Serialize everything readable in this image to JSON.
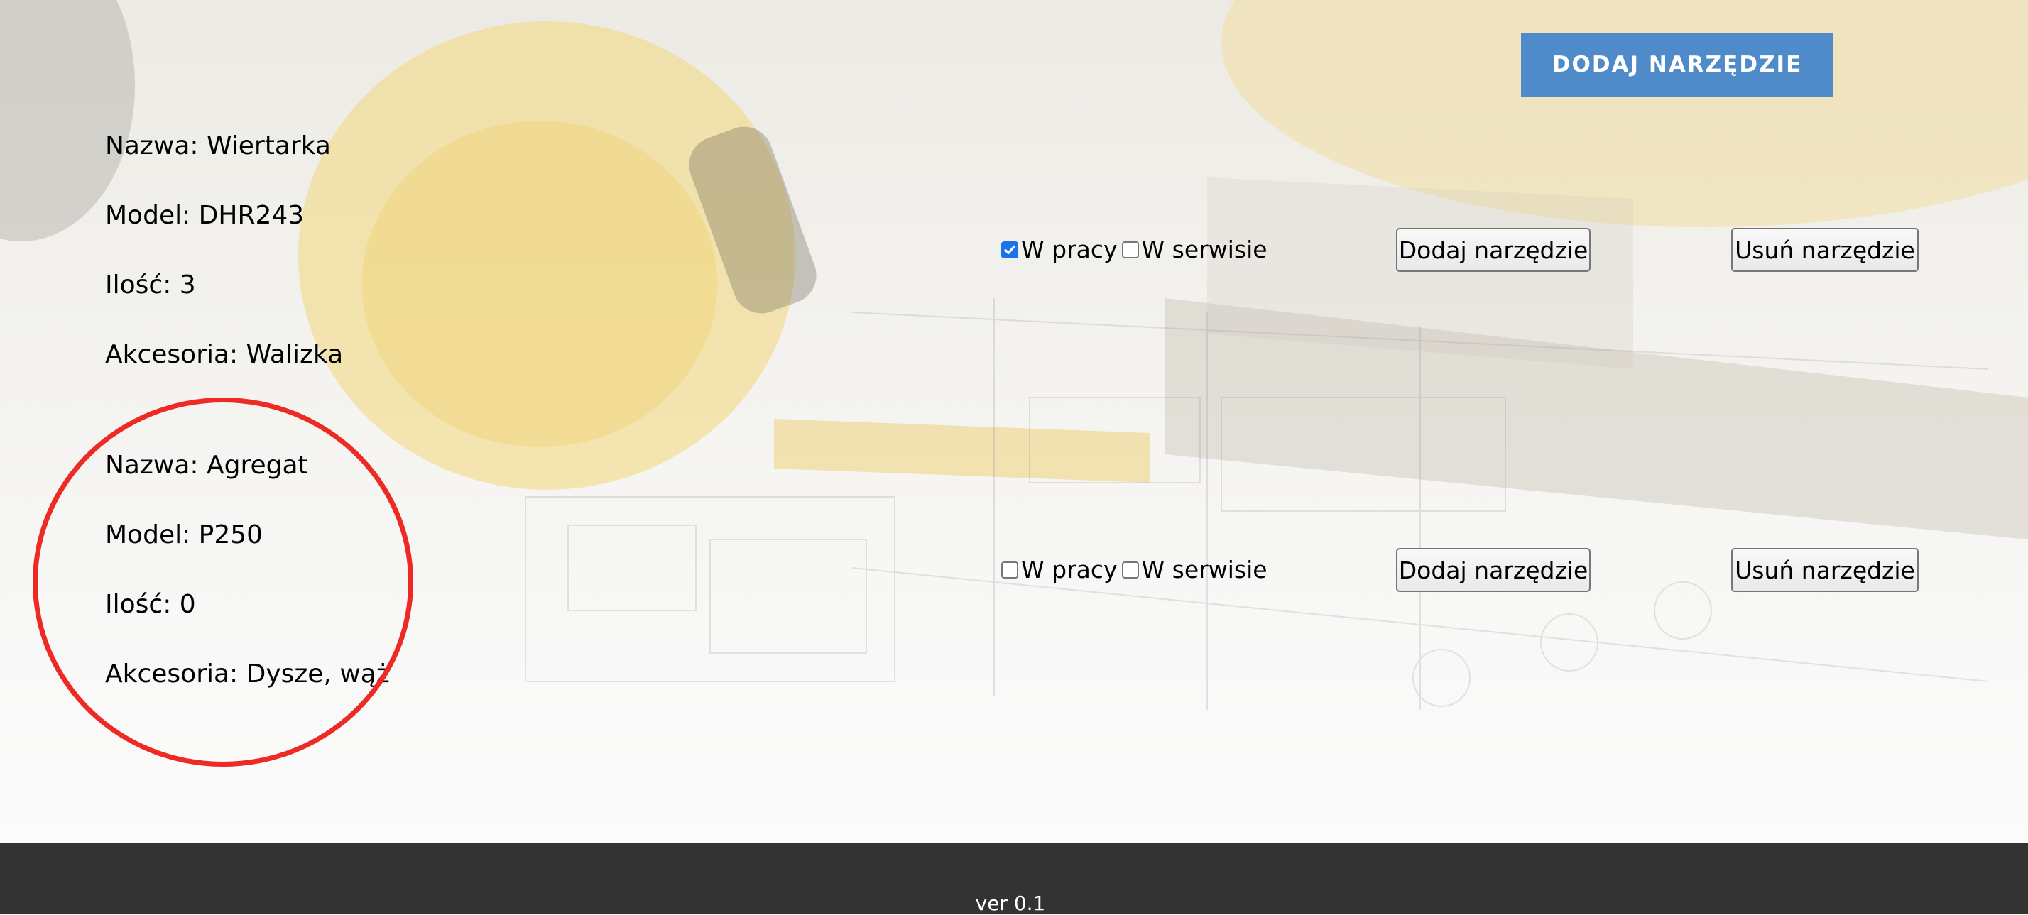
{
  "header": {
    "add_tool_button": "DODAJ NARZĘDZIE"
  },
  "tools": [
    {
      "name_line": "Nazwa: Wiertarka",
      "model_line": "Model: DHR243",
      "quantity_line": "Ilość: 3",
      "accessories_line": "Akcesoria: Walizka",
      "status_in_work_label": "W pracy",
      "status_in_work_checked": true,
      "status_in_service_label": "W serwisie",
      "status_in_service_checked": false,
      "add_button": "Dodaj narzędzie",
      "remove_button": "Usuń narzędzie"
    },
    {
      "name_line": "Nazwa: Agregat",
      "model_line": "Model: P250",
      "quantity_line": "Ilość: 0",
      "accessories_line": "Akcesoria: Dysze, wąż",
      "status_in_work_label": "W pracy",
      "status_in_work_checked": false,
      "status_in_service_label": "W serwisie",
      "status_in_service_checked": false,
      "add_button": "Dodaj narzędzie",
      "remove_button": "Usuń narzędzie"
    }
  ],
  "footer": {
    "version": "ver 0.1"
  },
  "colors": {
    "primary_button": "#4f8ac9",
    "footer_background": "#333333",
    "highlight_circle": "#ee2a24",
    "checkbox_checked": "#1a73e8"
  }
}
